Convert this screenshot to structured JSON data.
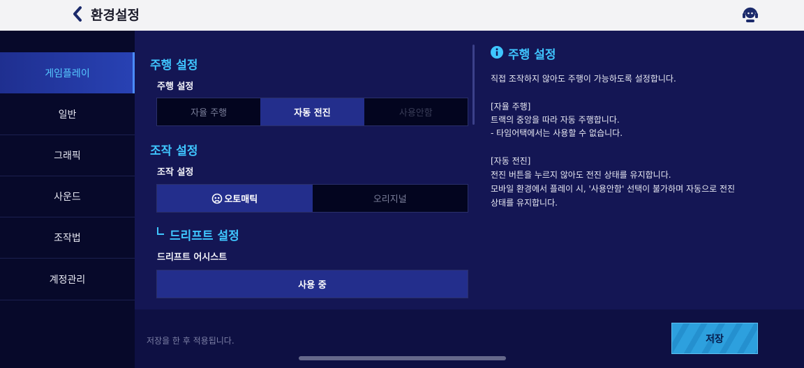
{
  "header": {
    "title": "환경설정",
    "back_icon": "chevron-left-icon",
    "support_icon": "headset-icon"
  },
  "sidebar": {
    "items": [
      {
        "label": "게임플레이",
        "active": true
      },
      {
        "label": "일반"
      },
      {
        "label": "그래픽"
      },
      {
        "label": "사운드"
      },
      {
        "label": "조작법"
      },
      {
        "label": "계정관리"
      }
    ]
  },
  "driving": {
    "section_title": "주행 설정",
    "label": "주행 설정",
    "options": [
      "자율 주행",
      "자동 전진",
      "사용안함"
    ],
    "selected": "자동 전진"
  },
  "control": {
    "section_title": "조작 설정",
    "label": "조작 설정",
    "options": [
      "오토매틱",
      "오리지널"
    ],
    "selected": "오토매틱",
    "auto_icon": "robot-icon"
  },
  "drift": {
    "section_title": "드리프트 설정",
    "label": "드리프트 어시스트",
    "value": "사용 중"
  },
  "info": {
    "icon": "info-icon",
    "title": "주행 설정",
    "lines": [
      "직접 조작하지 않아도 주행이 가능하도록 설정합니다.",
      "[자율 주행]",
      "트랙의 중앙을 따라 자동 주행합니다.",
      "- 타임어택에서는 사용할 수 없습니다.",
      "[자동 전진]",
      "전진 버튼을 누르지 않아도 전진 상태를 유지합니다.",
      "모바일 환경에서 플레이 시, '사용안함' 선택이 불가하며 자동으로 전진",
      "상태를 유지합니다."
    ]
  },
  "footer": {
    "hint": "저장을 한 후 적용됩니다.",
    "save_label": "저장"
  },
  "colors": {
    "accent": "#3fc6ff",
    "selected": "#232e8c",
    "save": "#2da0de"
  }
}
